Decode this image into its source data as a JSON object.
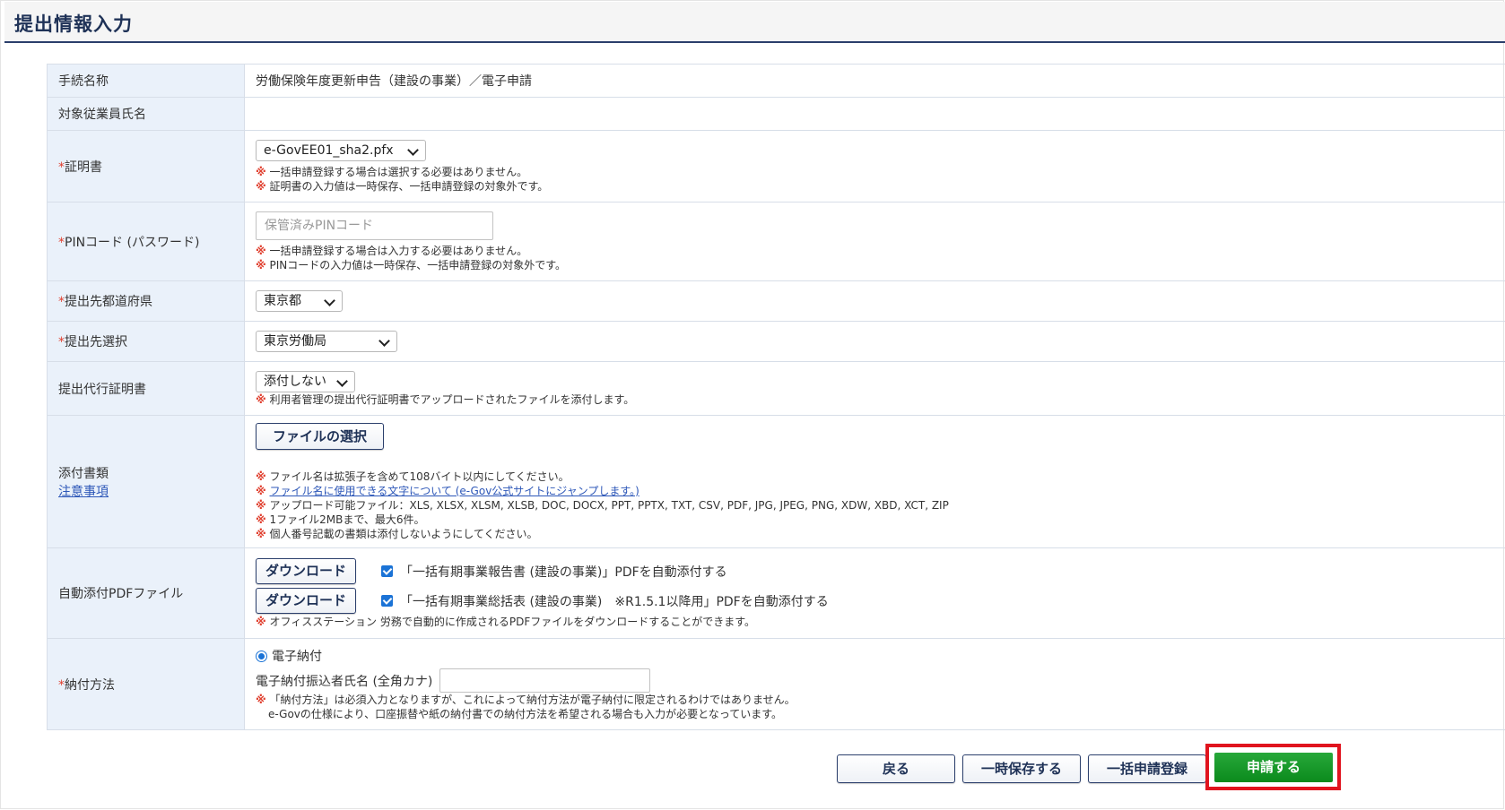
{
  "page": {
    "title": "提出情報入力"
  },
  "rows": {
    "procedure": {
      "label": "手続名称",
      "value": "労働保険年度更新申告（建設の事業）／電子申請"
    },
    "employee": {
      "label": "対象従業員氏名",
      "value": ""
    },
    "certificate": {
      "req": "*",
      "label": "証明書",
      "selected": "e-GovEE01_sha2.pfx",
      "notes": [
        "一括申請登録する場合は選択する必要はありません。",
        "証明書の入力値は一時保存、一括申請登録の対象外です。"
      ]
    },
    "pin": {
      "req": "*",
      "label": "PINコード (パスワード)",
      "placeholder": "保管済みPINコード",
      "notes": [
        "一括申請登録する場合は入力する必要はありません。",
        "PINコードの入力値は一時保存、一括申請登録の対象外です。"
      ]
    },
    "prefecture": {
      "req": "*",
      "label": "提出先都道府県",
      "selected": "東京都"
    },
    "destination": {
      "req": "*",
      "label": "提出先選択",
      "selected": "東京労働局"
    },
    "proxy_cert": {
      "label": "提出代行証明書",
      "selected": "添付しない",
      "notes": [
        "利用者管理の提出代行証明書でアップロードされたファイルを添付します。"
      ]
    },
    "attachments": {
      "label": "添付書類",
      "link": "注意事項",
      "button": "ファイルの選択",
      "notes": [
        "ファイル名は拡張子を含めて108バイト以内にしてください。",
        "アップロード可能ファイル：XLS, XLSX, XLSM, XLSB, DOC, DOCX, PPT, PPTX, TXT, CSV, PDF, JPG, JPEG, PNG, XDW, XBD, XCT, ZIP",
        "1ファイル2MBまで、最大6件。",
        "個人番号記載の書類は添付しないようにしてください。"
      ],
      "link_note": "ファイル名に使用できる文字について (e-Gov公式サイトにジャンプします。)"
    },
    "auto_pdf": {
      "label": "自動添付PDFファイル",
      "download_label": "ダウンロード",
      "items": [
        "「一括有期事業報告書 (建設の事業)」PDFを自動添付する",
        "「一括有期事業総括表 (建設の事業)　※R1.5.1以降用」PDFを自動添付する"
      ],
      "note": "オフィスステーション 労務で自動的に作成されるPDFファイルをダウンロードすることができます。"
    },
    "payment": {
      "req": "*",
      "label": "納付方法",
      "option": "電子納付",
      "name_label": "電子納付振込者氏名 (全角カナ)",
      "name_value": "",
      "notes": [
        "「納付方法」は必須入力となりますが、これによって納付方法が電子納付に限定されるわけではありません。",
        "e-Govの仕様により、口座振替や紙の納付書での納付方法を希望される場合も入力が必要となっています。"
      ]
    }
  },
  "note_mark": "※",
  "footer": {
    "back": "戻る",
    "save": "一時保存する",
    "batch": "一括申請登録",
    "submit": "申請する"
  },
  "colors": {
    "label_bg": "#eaf1fa",
    "accent_navy": "#1f3257",
    "note_mark": "#e0402f",
    "submit_green": "#0b8a1c",
    "highlight_red": "#e0141e"
  }
}
